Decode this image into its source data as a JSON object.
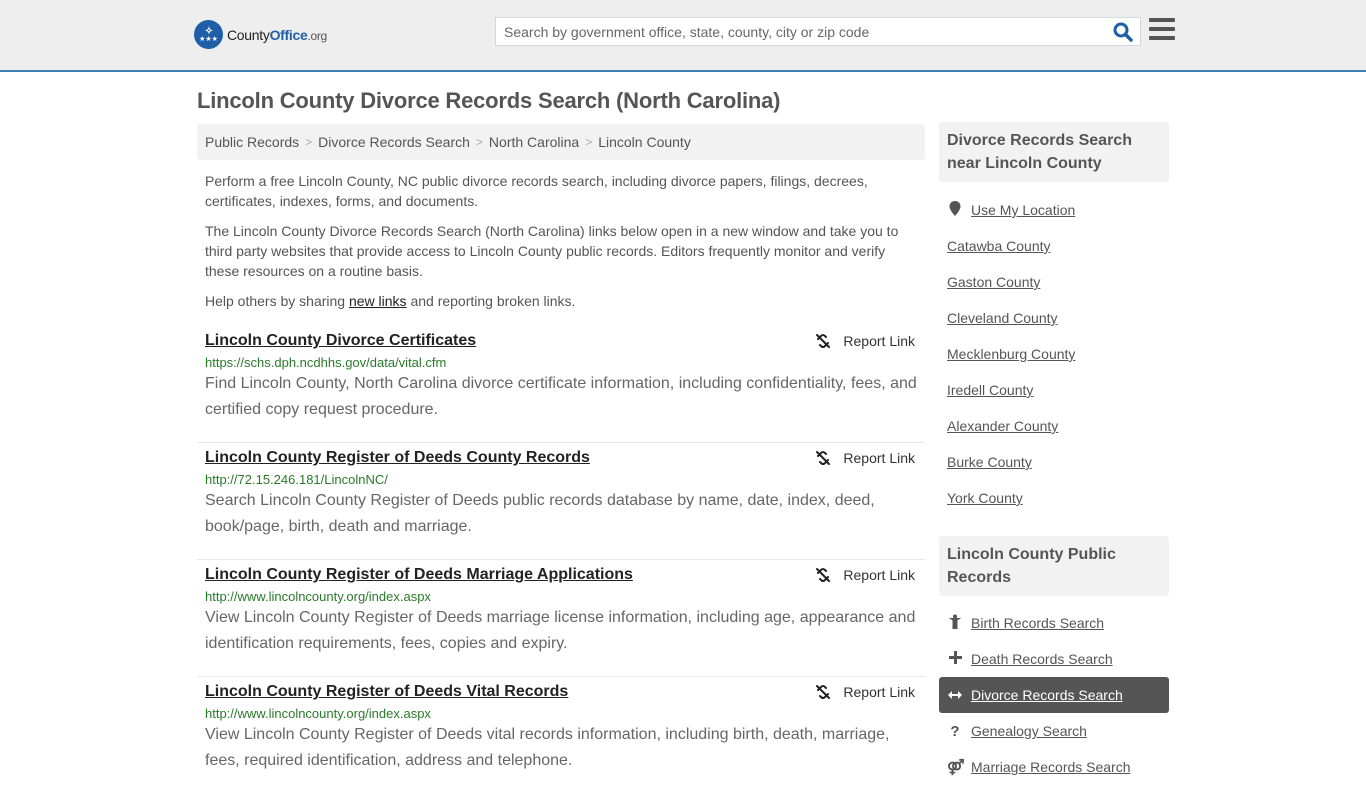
{
  "header": {
    "logo": {
      "county": "County",
      "office": "Office",
      "org": ".org"
    },
    "search_placeholder": "Search by government office, state, county, city or zip code",
    "search_value": ""
  },
  "page_title": "Lincoln County Divorce Records Search (North Carolina)",
  "breadcrumb": [
    {
      "label": "Public Records"
    },
    {
      "label": "Divorce Records Search"
    },
    {
      "label": "North Carolina"
    },
    {
      "label": "Lincoln County"
    }
  ],
  "intro": {
    "p1": "Perform a free Lincoln County, NC public divorce records search, including divorce papers, filings, decrees, certificates, indexes, forms, and documents.",
    "p2": "The Lincoln County Divorce Records Search (North Carolina) links below open in a new window and take you to third party websites that provide access to Lincoln County public records. Editors frequently monitor and verify these resources on a routine basis.",
    "p3_before": "Help others by sharing ",
    "p3_link": "new links",
    "p3_after": " and reporting broken links."
  },
  "report_label": "Report Link",
  "results": [
    {
      "title": "Lincoln County Divorce Certificates",
      "url": "https://schs.dph.ncdhhs.gov/data/vital.cfm",
      "desc": "Find Lincoln County, North Carolina divorce certificate information, including confidentiality, fees, and certified copy request procedure."
    },
    {
      "title": "Lincoln County Register of Deeds County Records",
      "url": "http://72.15.246.181/LincolnNC/",
      "desc": "Search Lincoln County Register of Deeds public records database by name, date, index, deed, book/page, birth, death and marriage."
    },
    {
      "title": "Lincoln County Register of Deeds Marriage Applications",
      "url": "http://www.lincolncounty.org/index.aspx",
      "desc": "View Lincoln County Register of Deeds marriage license information, including age, appearance and identification requirements, fees, copies and expiry."
    },
    {
      "title": "Lincoln County Register of Deeds Vital Records",
      "url": "http://www.lincolncounty.org/index.aspx",
      "desc": "View Lincoln County Register of Deeds vital records information, including birth, death, marriage, fees, required identification, address and telephone."
    }
  ],
  "sidebar": {
    "nearby_title": "Divorce Records Search near Lincoln County",
    "use_location": "Use My Location",
    "nearby": [
      "Catawba County",
      "Gaston County",
      "Cleveland County",
      "Mecklenburg County",
      "Iredell County",
      "Alexander County",
      "Burke County",
      "York County"
    ],
    "public_title": "Lincoln County Public Records",
    "public_links": [
      {
        "label": "Birth Records Search",
        "icon": "child-icon",
        "glyph": "ᾝ2"
      },
      {
        "label": "Death Records Search",
        "icon": "plus-icon",
        "glyph": "+"
      },
      {
        "label": "Divorce Records Search",
        "icon": "arrows-horizontal-icon",
        "glyph": "↔",
        "active": true
      },
      {
        "label": "Genealogy Search",
        "icon": "question-icon",
        "glyph": "?"
      },
      {
        "label": "Marriage Records Search",
        "icon": "marriage-icon",
        "glyph": "⚤"
      }
    ]
  },
  "colors": {
    "brand_blue": "#1f5fa8",
    "header_border": "#3a7fb5",
    "url_green": "#2a7a2a",
    "active_bg": "#555555"
  }
}
